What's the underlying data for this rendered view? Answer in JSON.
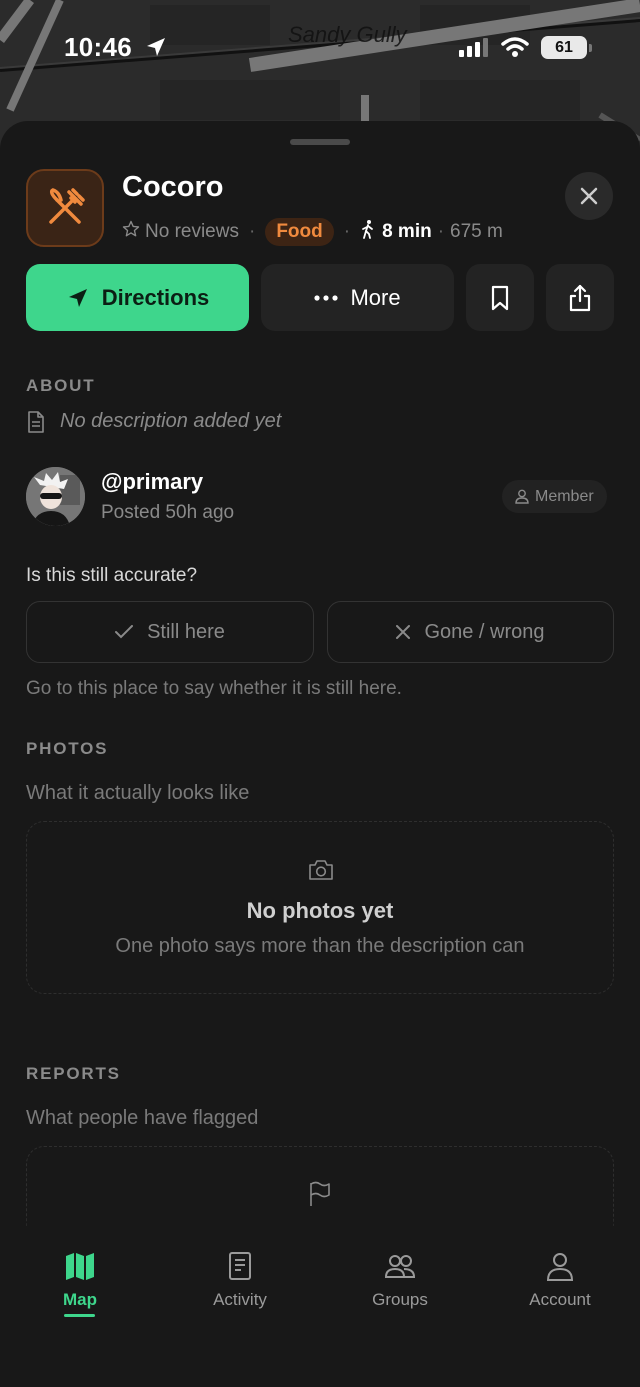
{
  "status_bar": {
    "time": "10:46",
    "battery": "61",
    "map_street_label": "Sandy Gully"
  },
  "place": {
    "name": "Cocoro",
    "reviews": "No reviews",
    "category": "Food",
    "walk_time": "8 min",
    "distance": "675 m"
  },
  "actions": {
    "directions": "Directions",
    "more": "More"
  },
  "about": {
    "label": "ABOUT",
    "description": "No description added yet"
  },
  "poster": {
    "username": "@primary",
    "posted": "Posted 50h ago",
    "role": "Member"
  },
  "accuracy": {
    "question": "Is this still accurate?",
    "still_here": "Still here",
    "gone": "Gone / wrong",
    "hint": "Go to this place to say whether it is still here."
  },
  "photos": {
    "label": "PHOTOS",
    "subtitle": "What it actually looks like",
    "empty_title": "No photos yet",
    "empty_sub": "One photo says more than the description can"
  },
  "reports": {
    "label": "REPORTS",
    "subtitle": "What people have flagged"
  },
  "tabs": [
    {
      "label": "Map",
      "icon": "map-icon",
      "active": true
    },
    {
      "label": "Activity",
      "icon": "document-icon",
      "active": false
    },
    {
      "label": "Groups",
      "icon": "people-icon",
      "active": false
    },
    {
      "label": "Account",
      "icon": "user-icon",
      "active": false
    }
  ],
  "colors": {
    "accent": "#3ed68c",
    "food": "#f08a3e",
    "background": "#181818"
  }
}
